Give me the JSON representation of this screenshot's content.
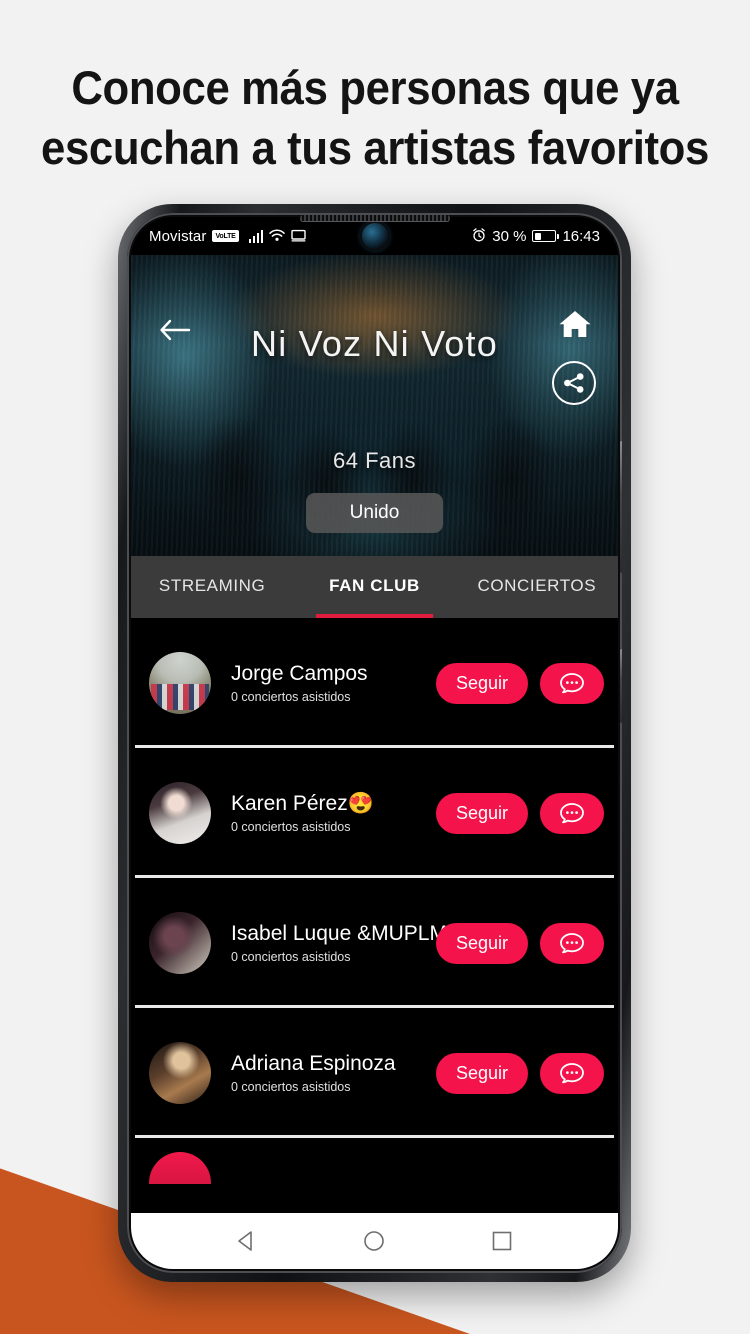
{
  "headline": {
    "line1": "Conoce más personas que ya",
    "line2": "escuchan a tus artistas favoritos"
  },
  "colors": {
    "accent_red": "#f4134b",
    "tab_underline": "#e31b3d",
    "orange_corner": "#c8551f",
    "page_background": "#f2f2f2",
    "tab_bar": "#3b3b3b",
    "app_background": "#000000"
  },
  "status_bar": {
    "carrier": "Movistar",
    "volte_badge": "VoLTE",
    "signal_icon": "signal-bars-icon",
    "wifi_icon": "wifi-icon",
    "cast_icon": "screen-cast-icon",
    "alarm_icon": "alarm-clock-icon",
    "battery_percent": "30 %",
    "battery_icon": "battery-icon",
    "time": "16:43"
  },
  "hero": {
    "back_icon": "back-arrow-icon",
    "home_icon": "home-icon",
    "share_icon": "share-icon",
    "artist_name": "Ni Voz Ni Voto",
    "fans_count": "64 Fans",
    "join_button": "Unido"
  },
  "tabs": [
    {
      "label": "STREAMING",
      "active": false
    },
    {
      "label": "FAN CLUB",
      "active": true
    },
    {
      "label": "CONCIERTOS",
      "active": false
    }
  ],
  "fan_list": {
    "follow_label": "Seguir",
    "chat_icon": "chat-bubble-icon",
    "rows": [
      {
        "name": "Jorge Campos",
        "subtitle": "0 conciertos asistidos",
        "avatar": "group-photo-avatar"
      },
      {
        "name": "Karen Pérez😍",
        "subtitle": "0 conciertos asistidos",
        "avatar": "woman-desk-avatar"
      },
      {
        "name": "Isabel Luque &MUPLMT",
        "subtitle": "0 conciertos asistidos",
        "avatar": "woman-dark-avatar"
      },
      {
        "name": "Adriana Espinoza",
        "subtitle": "0 conciertos asistidos",
        "avatar": "woman-concert-avatar"
      }
    ]
  },
  "android_nav": {
    "back": "nav-back-icon",
    "home": "nav-home-icon",
    "recents": "nav-recents-icon"
  }
}
